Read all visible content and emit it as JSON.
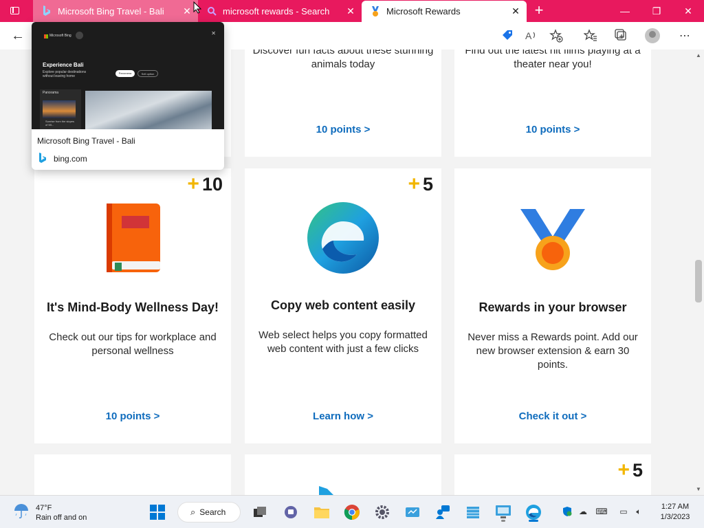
{
  "browser": {
    "tabs": [
      {
        "title": "Microsoft Bing Travel - Bali",
        "icon": "bing-icon"
      },
      {
        "title": "microsoft rewards - Search",
        "icon": "bing-search-icon"
      },
      {
        "title": "Microsoft Rewards",
        "icon": "rewards-icon"
      }
    ],
    "window_controls": {
      "minimize": "—",
      "maximize": "❐",
      "close": "✕"
    },
    "toolbar_icons": [
      "rewards-tag-icon",
      "read-aloud-icon",
      "favorite-add-icon",
      "favorites-icon",
      "collections-icon",
      "profile-avatar",
      "more-icon"
    ]
  },
  "tab_preview": {
    "title": "Microsoft Bing Travel - Bali",
    "domain": "bing.com",
    "thumb": {
      "brand": "Microsoft Bing",
      "heading": "Experience Bali",
      "subtitle": "Explore popular destinations without leaving home",
      "pill1": "Panorama",
      "pill2": "Sell option",
      "panel_label": "Panorama",
      "panel_caption": "Sunrise from the slopes of Mt..."
    }
  },
  "cards_top": [
    {
      "body": "Discover fun facts about these stunning animals today",
      "link": "10 points >"
    },
    {
      "body": "Find out the latest hit films playing at a theater near you!",
      "link": "10 points >"
    }
  ],
  "cards_middle": [
    {
      "badge_plus": "+",
      "badge_value": "10",
      "title": "It's Mind-Body Wellness Day!",
      "body": "Check out our tips for workplace and personal wellness",
      "link": "10 points >",
      "icon": "book-icon"
    },
    {
      "badge_plus": "+",
      "badge_value": "5",
      "title": "Copy web content easily",
      "body": "Web select helps you copy formatted web content with just a few clicks",
      "link": "Learn how >",
      "icon": "edge-logo-icon"
    },
    {
      "title": "Rewards in your browser",
      "body": "Never miss a Rewards point. Add our new browser extension & earn 30 points.",
      "link": "Check it out >",
      "icon": "medal-icon"
    }
  ],
  "cards_bottom": [
    {
      "badge_plus": "+",
      "badge_value": "5"
    }
  ],
  "taskbar": {
    "weather_temp": "47°F",
    "weather_desc": "Rain off and on",
    "search_label": "Search",
    "time": "1:27 AM",
    "date": "1/3/2023"
  },
  "colors": {
    "accent_tab_bar": "#e8195e",
    "link_blue": "#0f6cbd",
    "badge_plus": "#f2b600"
  }
}
